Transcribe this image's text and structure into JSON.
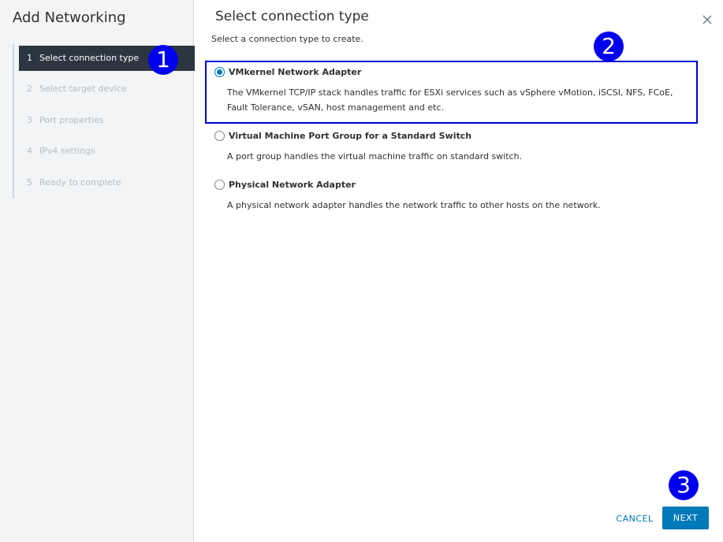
{
  "wizard": {
    "title": "Add Networking",
    "steps": [
      {
        "num": "1",
        "label": "Select connection type",
        "active": true
      },
      {
        "num": "2",
        "label": "Select target device"
      },
      {
        "num": "3",
        "label": "Port properties"
      },
      {
        "num": "4",
        "label": "IPv4 settings"
      },
      {
        "num": "5",
        "label": "Ready to complete"
      }
    ]
  },
  "dialog": {
    "title": "Select connection type",
    "subtitle": "Select a connection type to create.",
    "close_icon": "close-icon"
  },
  "options": [
    {
      "label": "VMkernel Network Adapter",
      "description": "The VMkernel TCP/IP stack handles traffic for ESXi services such as vSphere vMotion, iSCSI, NFS, FCoE, Fault Tolerance, vSAN, host management and etc.",
      "selected": true
    },
    {
      "label": "Virtual Machine Port Group for a Standard Switch",
      "description": "A port group handles the virtual machine traffic on standard switch.",
      "selected": false
    },
    {
      "label": "Physical Network Adapter",
      "description": "A physical network adapter handles the network traffic to other hosts on the network.",
      "selected": false
    }
  ],
  "footer": {
    "cancel_label": "CANCEL",
    "next_label": "NEXT"
  },
  "markers": [
    "1",
    "2",
    "3"
  ],
  "colors": {
    "accent": "#0079b8",
    "active_step_bg": "#2b3640",
    "marker": "#0000f0"
  }
}
